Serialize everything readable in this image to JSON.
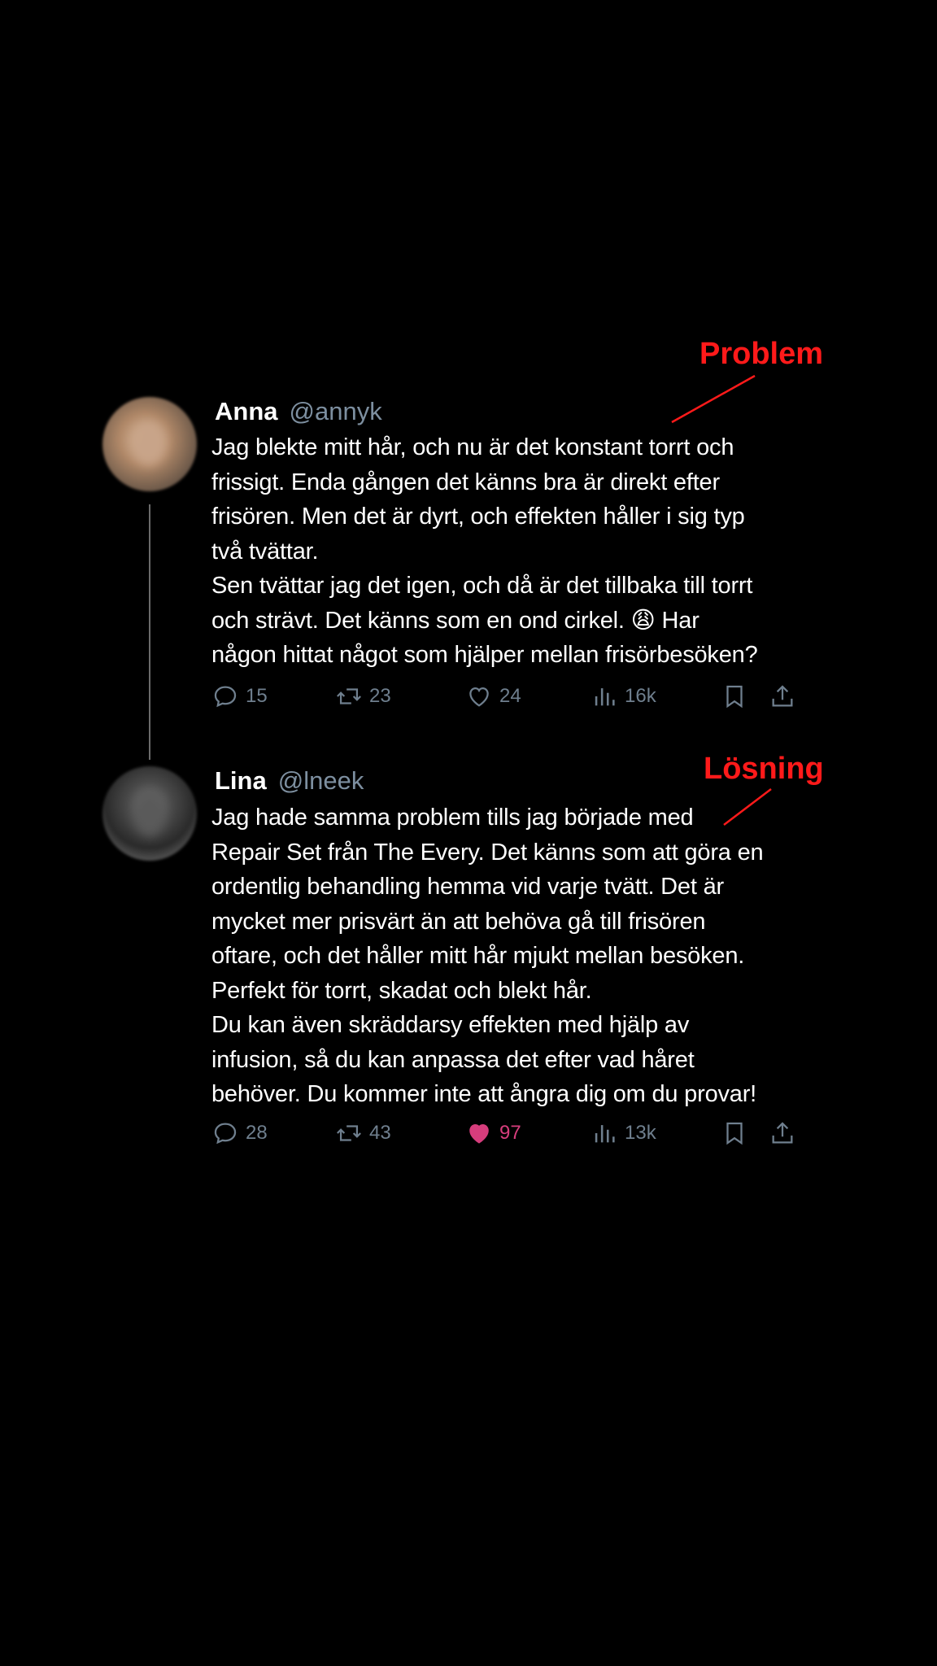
{
  "thread": {
    "tweets": [
      {
        "display_name": "Anna",
        "handle": "@annyk",
        "text": "Jag blekte mitt hår, och nu är det konstant torrt och\nfrissigt. Enda gången det känns bra är direkt efter\nfrisören. Men det är dyrt, och effekten håller i sig typ\ntvå tvättar.\nSen tvättar jag det igen, och då är det tillbaka till torrt\noch strävt. Det känns som en ond cirkel. 😩 Har\nnågon hittat något som hjälper mellan frisörbesöken?",
        "replies": "15",
        "retweets": "23",
        "likes": "24",
        "views": "16k",
        "liked": false
      },
      {
        "display_name": "Lina",
        "handle": "@lneek",
        "text": "Jag hade samma problem tills jag började med\nRepair Set från The Every. Det känns som att göra en\nordentlig behandling hemma vid varje tvätt. Det är\nmycket mer prisvärt än att behöva gå till frisören\noftare, och det håller mitt hår mjukt mellan besöken.\nPerfekt för torrt, skadat och blekt hår.\nDu kan även skräddarsy effekten med hjälp av\ninfusion, så du kan anpassa det efter vad håret\nbehöver. Du kommer inte att ångra dig om du provar!",
        "replies": "28",
        "retweets": "43",
        "likes": "97",
        "views": "13k",
        "liked": true
      }
    ]
  },
  "annotations": {
    "problem_label": "Problem",
    "solution_label": "Lösning",
    "color": "#ff1a1a"
  },
  "colors": {
    "background": "#000000",
    "handle": "#7d8fa0",
    "action": "#6f7f8e",
    "liked": "#d63d7c"
  },
  "icons": [
    "reply-icon",
    "retweet-icon",
    "heart-icon",
    "views-icon",
    "bookmark-icon",
    "share-icon"
  ]
}
